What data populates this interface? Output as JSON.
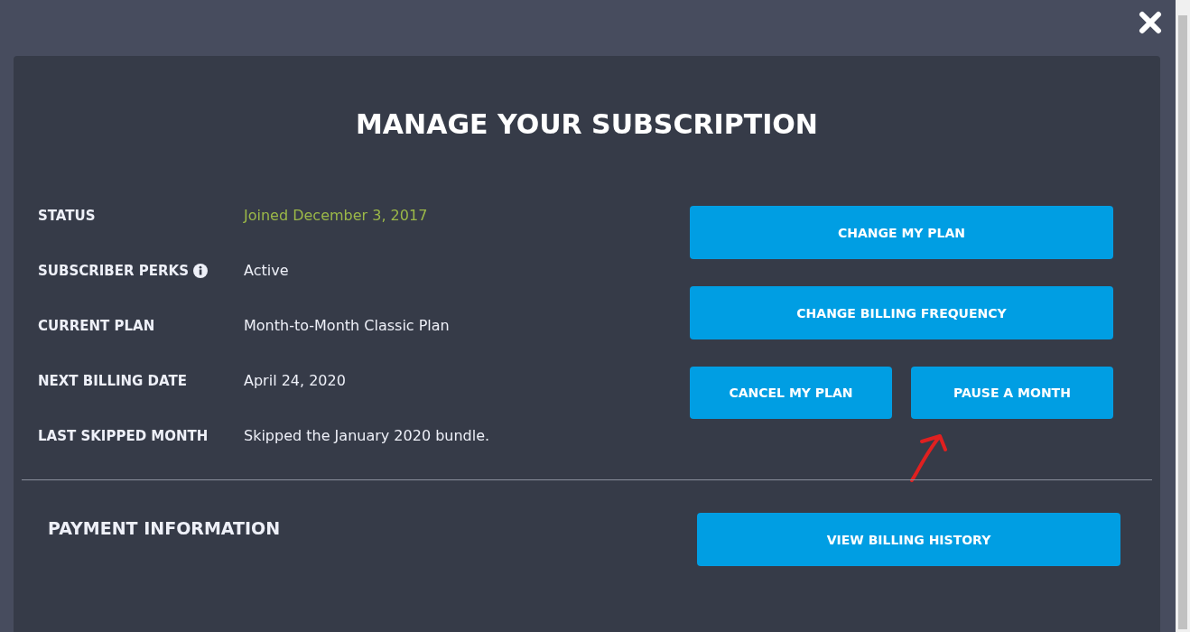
{
  "title": "MANAGE YOUR SUBSCRIPTION",
  "details": [
    {
      "label": "STATUS",
      "value": "Joined December 3, 2017",
      "color": "#9bb848",
      "has_info": false
    },
    {
      "label": "SUBSCRIBER PERKS",
      "value": "Active",
      "color": "#eef0f8",
      "has_info": true
    },
    {
      "label": "CURRENT PLAN",
      "value": "Month-to-Month Classic Plan",
      "color": "#eef0f8",
      "has_info": false
    },
    {
      "label": "NEXT BILLING DATE",
      "value": "April 24, 2020",
      "color": "#eef0f8",
      "has_info": false
    },
    {
      "label": "LAST SKIPPED MONTH",
      "value": "Skipped the January 2020 bundle.",
      "color": "#eef0f8",
      "has_info": false
    }
  ],
  "actions": [
    {
      "label": "CHANGE MY PLAN",
      "kind": "wide"
    },
    {
      "label": "CHANGE BILLING FREQUENCY",
      "kind": "wide"
    },
    {
      "label": "CANCEL MY PLAN",
      "kind": "half"
    },
    {
      "label": "PAUSE A MONTH",
      "kind": "half"
    }
  ],
  "payment": {
    "heading": "PAYMENT INFORMATION",
    "button": "VIEW BILLING HISTORY"
  }
}
